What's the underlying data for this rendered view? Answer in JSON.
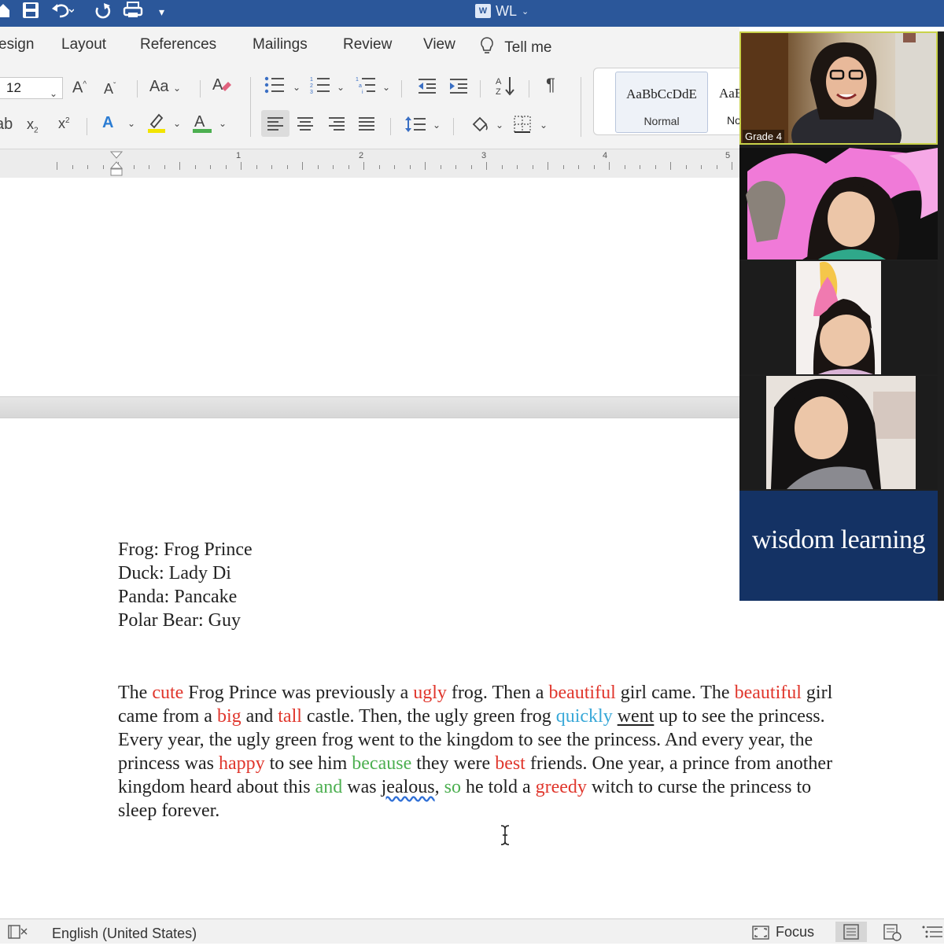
{
  "app": {
    "title": "WL",
    "word_badge": "W"
  },
  "quick_access": [
    "home-icon",
    "save-icon",
    "undo-icon",
    "redo-icon",
    "print-icon",
    "customize-icon"
  ],
  "tabs": [
    "esign",
    "Layout",
    "References",
    "Mailings",
    "Review",
    "View",
    "Tell me"
  ],
  "ribbon": {
    "font_size": "12",
    "change_case_label": "Aa",
    "styles": {
      "normal_sample": "AaBbCcDdE",
      "normal_name": "Normal",
      "next_sample": "AaB",
      "next_name": "No"
    }
  },
  "ruler": {
    "numbers": [
      "1",
      "2",
      "3",
      "4",
      "5"
    ]
  },
  "document": {
    "nicknames": [
      "Frog: Frog Prince",
      "Duck: Lady Di",
      "Panda: Pancake",
      "Polar Bear: Guy"
    ],
    "story_lines": [
      [
        {
          "t": "The ",
          "c": ""
        },
        {
          "t": "cute",
          "c": "red"
        },
        {
          "t": " Frog Prince was previously a ",
          "c": ""
        },
        {
          "t": "ugly",
          "c": "red"
        },
        {
          "t": " frog. Then a ",
          "c": ""
        },
        {
          "t": "beautiful",
          "c": "red"
        },
        {
          "t": " girl came. The ",
          "c": ""
        },
        {
          "t": "beautiful",
          "c": "red"
        },
        {
          "t": " girl",
          "c": ""
        }
      ],
      [
        {
          "t": "came from a ",
          "c": ""
        },
        {
          "t": "big",
          "c": "red"
        },
        {
          "t": " and ",
          "c": ""
        },
        {
          "t": "tall",
          "c": "red"
        },
        {
          "t": " castle. Then, the ugly green frog ",
          "c": ""
        },
        {
          "t": "quickly",
          "c": "blue"
        },
        {
          "t": " ",
          "c": ""
        },
        {
          "t": "went",
          "c": "ul"
        },
        {
          "t": " up to see the princess.",
          "c": ""
        }
      ],
      [
        {
          "t": "Every year, the ugly green frog went to the kingdom to see the princess. And every year, the",
          "c": ""
        }
      ],
      [
        {
          "t": "princess was ",
          "c": ""
        },
        {
          "t": "happy",
          "c": "red"
        },
        {
          "t": " to see him ",
          "c": ""
        },
        {
          "t": "because",
          "c": "green"
        },
        {
          "t": " they were ",
          "c": ""
        },
        {
          "t": "best",
          "c": "red"
        },
        {
          "t": " friends. One year, a prince from another",
          "c": ""
        }
      ],
      [
        {
          "t": "kingdom heard about this ",
          "c": ""
        },
        {
          "t": "and",
          "c": "green"
        },
        {
          "t": " was ",
          "c": ""
        },
        {
          "t": "jealous",
          "c": "spell"
        },
        {
          "t": ", ",
          "c": ""
        },
        {
          "t": "so",
          "c": "green"
        },
        {
          "t": " he told a ",
          "c": ""
        },
        {
          "t": "greedy",
          "c": "red"
        },
        {
          "t": " witch to curse the princess to",
          "c": ""
        }
      ],
      [
        {
          "t": "sleep forever.",
          "c": ""
        }
      ]
    ]
  },
  "statusbar": {
    "language": "English (United States)",
    "focus_label": "Focus"
  },
  "video_panel": {
    "teacher_label": "Grade 4",
    "brand": "wisdom learning"
  },
  "colors": {
    "title_bar": "#2b579a",
    "adjective_red": "#e0362c",
    "conjunction_green": "#4caf50",
    "adverb_blue": "#38a8d8",
    "brand_navy": "#143264",
    "active_speaker": "#c9d24a"
  }
}
